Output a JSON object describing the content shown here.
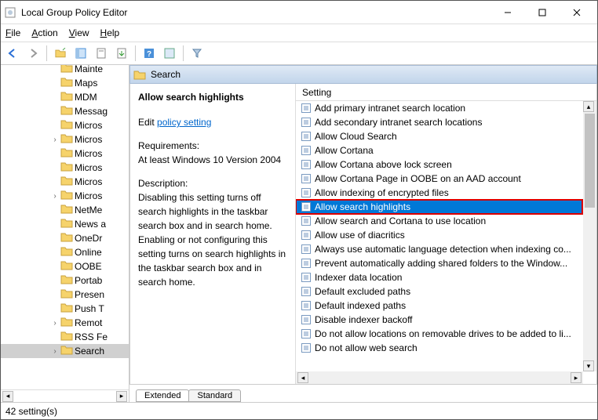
{
  "window": {
    "title": "Local Group Policy Editor"
  },
  "menu": {
    "file": "File",
    "action": "Action",
    "view": "View",
    "help": "Help"
  },
  "section": {
    "title": "Search"
  },
  "detail": {
    "title": "Allow search highlights",
    "edit_prefix": "Edit ",
    "edit_link": "policy setting ",
    "req_label": "Requirements:",
    "req_value": "At least Windows 10 Version 2004",
    "desc_label": "Description:",
    "desc_value": "Disabling this setting turns off search highlights in the taskbar search box and in search home. Enabling or not configuring this setting turns on search highlights in the taskbar search box and in search home."
  },
  "tree": [
    {
      "label": "Mainte",
      "exp": ""
    },
    {
      "label": "Maps",
      "exp": ""
    },
    {
      "label": "MDM",
      "exp": ""
    },
    {
      "label": "Messag",
      "exp": ""
    },
    {
      "label": "Micros",
      "exp": ""
    },
    {
      "label": "Micros",
      "exp": ">"
    },
    {
      "label": "Micros",
      "exp": ""
    },
    {
      "label": "Micros",
      "exp": ""
    },
    {
      "label": "Micros",
      "exp": ""
    },
    {
      "label": "Micros",
      "exp": ">"
    },
    {
      "label": "NetMe",
      "exp": ""
    },
    {
      "label": "News a",
      "exp": ""
    },
    {
      "label": "OneDr",
      "exp": ""
    },
    {
      "label": "Online",
      "exp": ""
    },
    {
      "label": "OOBE",
      "exp": ""
    },
    {
      "label": "Portab",
      "exp": ""
    },
    {
      "label": "Presen",
      "exp": ""
    },
    {
      "label": "Push T",
      "exp": ""
    },
    {
      "label": "Remot",
      "exp": ">"
    },
    {
      "label": "RSS Fe",
      "exp": ""
    },
    {
      "label": "Search",
      "exp": ">",
      "sel": true
    }
  ],
  "list_header": "Setting",
  "list": [
    "Add primary intranet search location",
    "Add secondary intranet search locations",
    "Allow Cloud Search",
    "Allow Cortana",
    "Allow Cortana above lock screen",
    "Allow Cortana Page in OOBE on an AAD account",
    "Allow indexing of encrypted files",
    "Allow search highlights",
    "Allow search and Cortana to use location",
    "Allow use of diacritics",
    "Always use automatic language detection when indexing co...",
    "Prevent automatically adding shared folders to the Window...",
    "Indexer data location",
    "Default excluded paths",
    "Default indexed paths",
    "Disable indexer backoff",
    "Do not allow locations on removable drives to be added to li...",
    "Do not allow web search"
  ],
  "selected_index": 7,
  "tabs": {
    "extended": "Extended",
    "standard": "Standard"
  },
  "status": "42 setting(s)"
}
